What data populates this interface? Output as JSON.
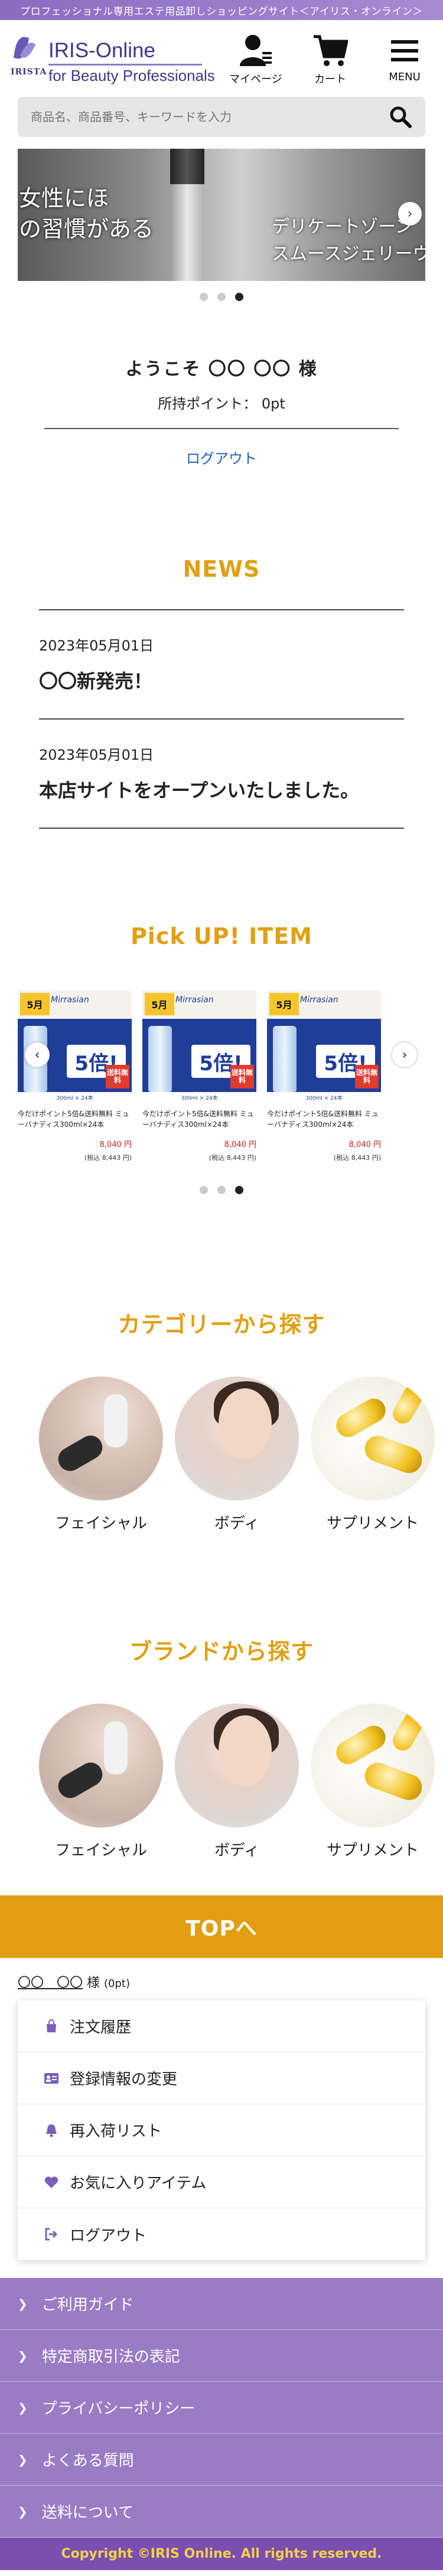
{
  "topbar": {
    "text": "プロフェッショナル専用エステ用品卸しショッピングサイト＜アイリス・オンライン＞"
  },
  "header": {
    "logo_brand": "IRISTA",
    "logo_title": "IRIS-Online",
    "logo_sub": "for Beauty Professionals",
    "icons": [
      {
        "label": "マイページ",
        "icon": "user-icon"
      },
      {
        "label": "カート",
        "icon": "cart-icon"
      },
      {
        "label": "MENU",
        "icon": "hamburger-icon"
      }
    ]
  },
  "search": {
    "placeholder": "商品名、商品番号、キーワードを入力"
  },
  "slider": {
    "text_left_1": "女性にほ",
    "text_left_2": "の習慣がある",
    "text_right_1": "デリケートゾーン",
    "text_right_2": "スムースジェリーウ"
  },
  "welcome": {
    "name": "ようこそ 〇〇 〇〇 様",
    "points": "所持ポイント： 0pt",
    "logout": "ログアウト"
  },
  "news": {
    "title": "NEWS",
    "items": [
      {
        "date": "2023年05月01日",
        "title": "〇〇新発売！"
      },
      {
        "date": "2023年05月01日",
        "title": "本店サイトをオープンいたしました。"
      }
    ]
  },
  "pickup": {
    "title": "Pick UP! ITEM",
    "products": [
      {
        "badge": "5月",
        "brand": "Mirrasian",
        "promo": "5倍!",
        "free": "送料無料",
        "strip": "300ml × 24本",
        "name": "今だけポイント5倍&送料無料 ミューバナディス300ml×24本",
        "price": "8,040 円",
        "tax": "(税込 8,443 円)"
      },
      {
        "badge": "5月",
        "brand": "Mirrasian",
        "promo": "5倍!",
        "free": "送料無料",
        "strip": "300ml × 24本",
        "name": "今だけポイント5倍&送料無料 ミューバナディス300ml×24本",
        "price": "8,040 円",
        "tax": "(税込 8,443 円)"
      },
      {
        "badge": "5月",
        "brand": "Mirrasian",
        "promo": "5倍!",
        "free": "送料無料",
        "strip": "300ml × 24本",
        "name": "今だけポイント5倍&送料無料 ミューバナディス300ml×24本",
        "price": "8,040 円",
        "tax": "(税込 8,443 円)"
      }
    ]
  },
  "category": {
    "title": "カテゴリーから探す",
    "items": [
      {
        "label": "フェイシャル"
      },
      {
        "label": "ボディ"
      },
      {
        "label": "サプリメント"
      }
    ]
  },
  "brand": {
    "title": "ブランドから探す",
    "items": [
      {
        "label": "フェイシャル"
      },
      {
        "label": "ボディ"
      },
      {
        "label": "サプリメント"
      }
    ]
  },
  "top_button": "TOPへ",
  "mypage": {
    "name": "〇〇　〇〇",
    "suffix": " 様 ",
    "points": "(0pt)",
    "menu": [
      {
        "label": "注文履歴",
        "icon": "bag-icon"
      },
      {
        "label": "登録情報の変更",
        "icon": "id-card-icon"
      },
      {
        "label": "再入荷リスト",
        "icon": "bell-icon"
      },
      {
        "label": "お気に入りアイテム",
        "icon": "heart-icon"
      },
      {
        "label": "ログアウト",
        "icon": "logout-icon"
      }
    ]
  },
  "footer_links": [
    {
      "label": "ご利用ガイド"
    },
    {
      "label": "特定商取引法の表記"
    },
    {
      "label": "プライバシーポリシー"
    },
    {
      "label": "よくある質問"
    },
    {
      "label": "送料について"
    }
  ],
  "copyright": "Copyright ©IRIS Online. All rights reserved.",
  "colors": {
    "accent": "#e0a012",
    "purple": "#9a7cc4",
    "link": "#1a5fb4",
    "price": "#d02020"
  }
}
